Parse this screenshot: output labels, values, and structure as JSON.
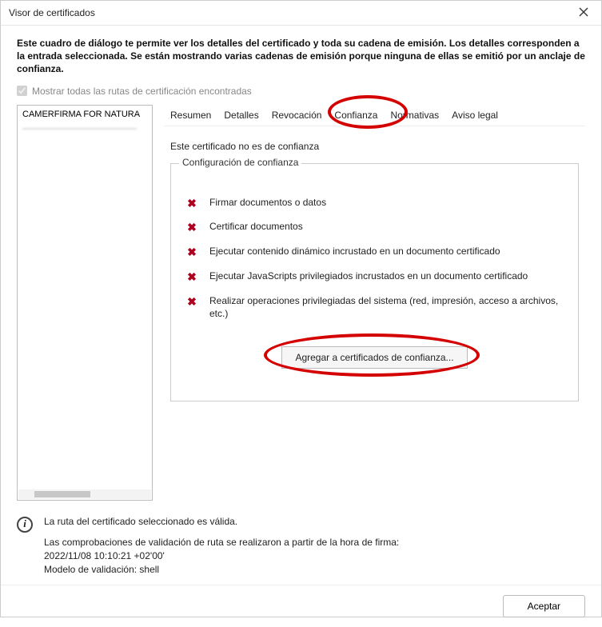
{
  "window": {
    "title": "Visor de certificados"
  },
  "intro": "Este cuadro de diálogo te permite ver los detalles del certificado y toda su cadena de emisión. Los detalles corresponden a la entrada seleccionada. Se están mostrando varias cadenas de emisión porque ninguna de ellas se emitió por un anclaje de confianza.",
  "checkbox": {
    "label": "Mostrar todas las rutas de certificación encontradas",
    "checked": true
  },
  "cert_list": {
    "items": [
      "CAMERFIRMA FOR NATURA",
      "—"
    ]
  },
  "tabs": {
    "items": [
      {
        "label": "Resumen"
      },
      {
        "label": "Detalles"
      },
      {
        "label": "Revocación"
      },
      {
        "label": "Confianza"
      },
      {
        "label": "Normativas"
      },
      {
        "label": "Aviso legal"
      }
    ],
    "active_index": 3
  },
  "trust_panel": {
    "status": "Este certificado no es de confianza",
    "legend": "Configuración de confianza",
    "items": [
      "Firmar documentos o datos",
      "Certificar documentos",
      "Ejecutar contenido dinámico incrustado en un documento certificado",
      "Ejecutar JavaScripts privilegiados incrustados en un documento certificado",
      "Realizar operaciones privilegiadas del sistema (red, impresión, acceso a archivos, etc.)"
    ],
    "add_button": "Agregar a certificados de confianza..."
  },
  "info": {
    "line1": "La ruta del certificado seleccionado es válida.",
    "line2": "Las comprobaciones de validación de ruta se realizaron a partir de la hora de firma:",
    "timestamp": "2022/11/08 10:10:21 +02'00'",
    "model_label": "Modelo de validación: shell"
  },
  "footer": {
    "accept": "Aceptar"
  }
}
